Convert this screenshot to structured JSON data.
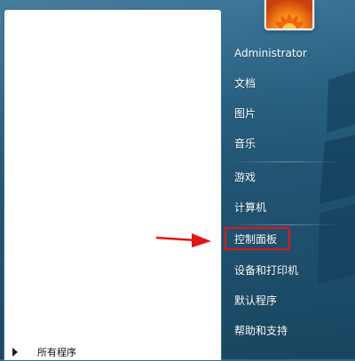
{
  "start_menu": {
    "user_name": "Administrator",
    "items": [
      {
        "label": "文档"
      },
      {
        "label": "图片"
      },
      {
        "label": "音乐"
      },
      {
        "label": "游戏"
      },
      {
        "label": "计算机"
      },
      {
        "label": "控制面板"
      },
      {
        "label": "设备和打印机"
      },
      {
        "label": "默认程序"
      },
      {
        "label": "帮助和支持"
      }
    ],
    "all_programs": "所有程序"
  },
  "colors": {
    "highlight_border": "#e21616",
    "pointer_arrow": "#e21616"
  }
}
